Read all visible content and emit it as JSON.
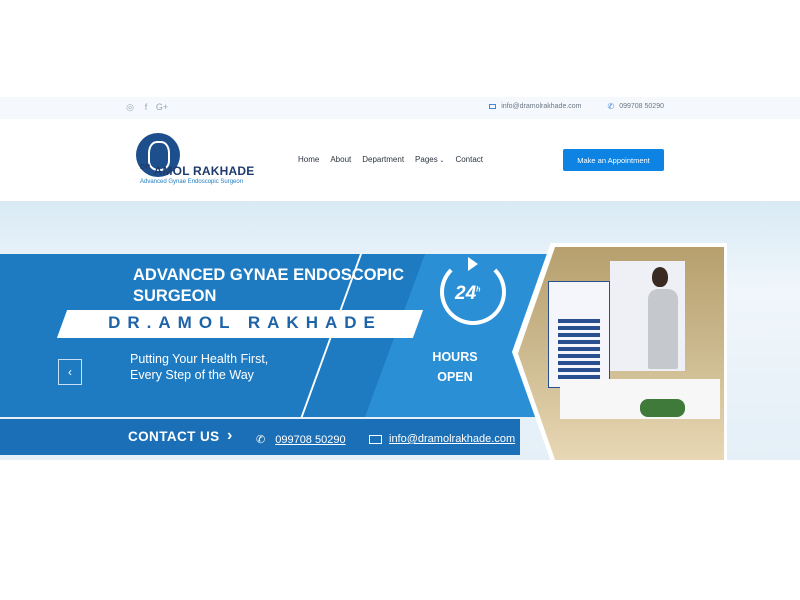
{
  "topbar": {
    "social_icons": [
      "instagram-icon",
      "facebook-icon",
      "google-plus-icon"
    ],
    "email": "info@dramolrakhade.com",
    "phone": "099708 50290"
  },
  "header": {
    "logo_name_prefix": "DR",
    "logo_name": "AMOL RAKHADE",
    "logo_tagline": "Advanced Gynae Endoscopic Surgeon",
    "nav": [
      "Home",
      "About",
      "Department",
      "Pages",
      "Contact"
    ],
    "cta": "Make an Appointment"
  },
  "banner": {
    "heading": "ADVANCED GYNAE ENDOSCOPIC SURGEON",
    "name": "DR.AMOL RAKHADE",
    "tagline_line1": "Putting Your Health First,",
    "tagline_line2": "Every Step of the Way",
    "clock_number": "24",
    "clock_suffix": "h",
    "hours_line1": "HOURS",
    "hours_line2": "OPEN",
    "contact_label": "CONTACT US",
    "phone": "099708 50290",
    "email": "info@dramolrakhade.com"
  },
  "colors": {
    "accent": "#0d84e3",
    "banner_blue": "#1e7bc2",
    "navy": "#1f3c6d"
  }
}
